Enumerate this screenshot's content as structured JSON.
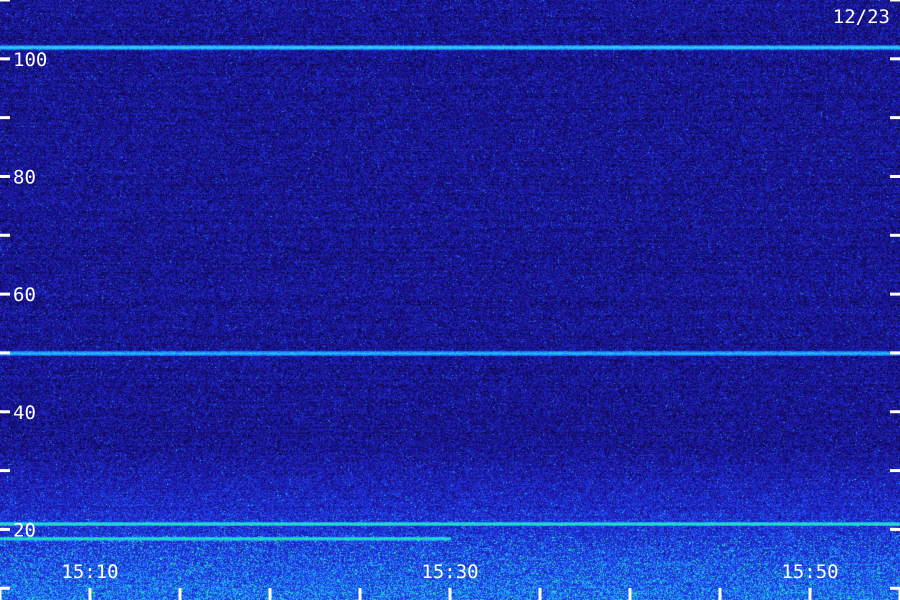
{
  "chart_data": {
    "type": "heatmap",
    "title": "",
    "date_label": "12/23",
    "xlabel": "",
    "ylabel": "",
    "x_range": [
      "15:05",
      "15:55"
    ],
    "x_ticks": [
      "15:10",
      "15:30",
      "15:50"
    ],
    "x_minor_step_minutes": 5,
    "y_range": [
      8,
      110
    ],
    "y_ticks": [
      20,
      40,
      60,
      80,
      100
    ],
    "y_minor_step": 10,
    "colormap": [
      "#0a0630",
      "#1c13a0",
      "#2040f0",
      "#21c8ff",
      "#21ff66"
    ],
    "background_color": "#120c49",
    "features": [
      {
        "label": "",
        "y_value": 102,
        "strength": 0.8,
        "x_start": "15:05",
        "x_end": "15:55"
      },
      {
        "label": "",
        "y_value": 50,
        "strength": 0.5,
        "x_start": "15:05",
        "x_end": "15:55"
      },
      {
        "label": "",
        "y_value": 21,
        "strength": 1.0,
        "x_start": "15:05",
        "x_end": "15:55"
      },
      {
        "label": "",
        "y_value": 18.5,
        "strength": 0.9,
        "x_start": "15:05",
        "x_end": "15:30"
      }
    ],
    "grid": false,
    "legend": "none"
  }
}
